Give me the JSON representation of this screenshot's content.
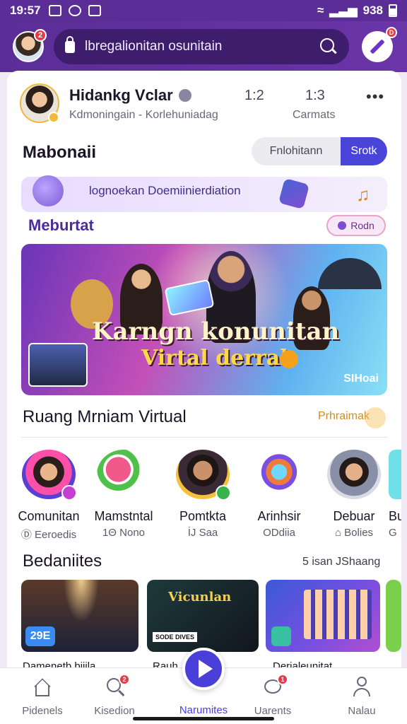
{
  "status_bar": {
    "time": "19:57",
    "battery_text": "938"
  },
  "header": {
    "search_placeholder": "lbregalionitan osunitain",
    "avatar_badge": "2",
    "edit_badge": "D"
  },
  "profile": {
    "name": "Hidankg Vclar",
    "subtitle": "Kdmoningain - Korlehuniadag",
    "stat1": "1:2",
    "stat2": "1:3",
    "stat2_label": "Carmats"
  },
  "featured": {
    "title": "Mabonaii",
    "segment_options": [
      "Fnlohitann",
      "Srotk"
    ],
    "promo_text": "lognoekan Doemiinierdiation",
    "sub_brand": "Meburtat",
    "pill_label": "Rodn",
    "banner": {
      "title_line1": "Karngn konunitan",
      "title_line2": "Virtal derral",
      "corner_label": "SIHoai"
    }
  },
  "section_rooms": {
    "title": "Ruang  Mrniam Virtual",
    "link": "Prhraimak",
    "items": [
      {
        "label": "Comunitan",
        "sub": "Ⓓ Eeroedis"
      },
      {
        "label": "Mamstntal",
        "sub": "1Θ Nono"
      },
      {
        "label": "Pomtkta",
        "sub": "İJ Saa"
      },
      {
        "label": "Arinhsir",
        "sub": "ODdiia"
      },
      {
        "label": "Debuar",
        "sub": "⌂ Bolies"
      },
      {
        "label": "Bu",
        "sub": "G"
      }
    ]
  },
  "section_activities": {
    "title": "Bedaniites",
    "link": "5 isan JShaang",
    "tiles": [
      {
        "caption": "Damenetb biiila",
        "tag": "29E"
      },
      {
        "caption": "Rauh",
        "overlay": "Vicunlan",
        "sub_overlay": "SODE DIVES"
      },
      {
        "caption": "Derialeunitat"
      }
    ]
  },
  "bottom_nav": {
    "items": [
      "Pidenels",
      "Kisedion",
      "Narumites",
      "Uarents",
      "Nalau"
    ],
    "badges": {
      "search": "2",
      "chat": "1"
    }
  },
  "colors": {
    "brand": "#5b2d96",
    "accent": "#4a3fd8",
    "badge": "#e23b4a",
    "link": "#d18b25"
  }
}
